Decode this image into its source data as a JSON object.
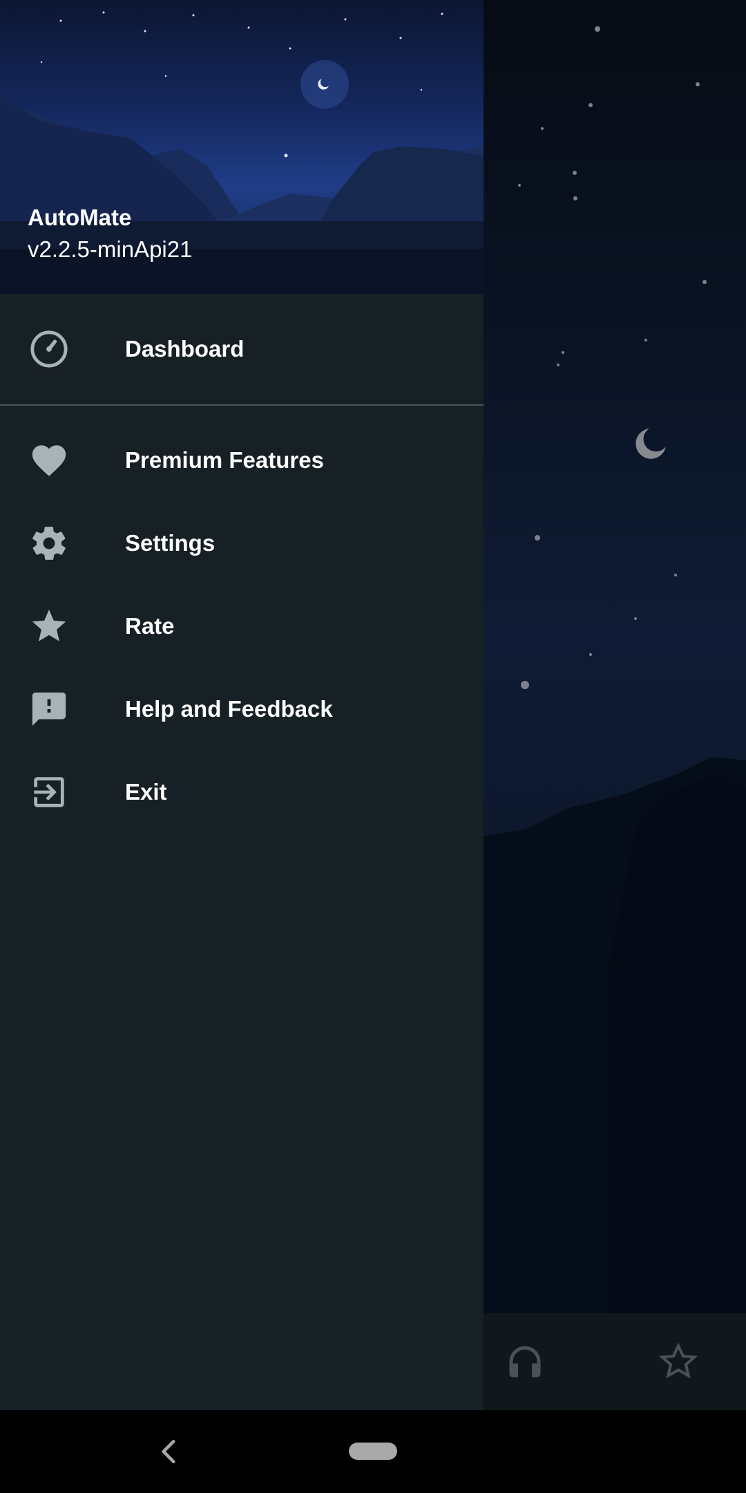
{
  "drawer": {
    "app_name": "AutoMate",
    "app_version": "v2.2.5-minApi21",
    "primary_items": [
      {
        "label": "Dashboard",
        "icon": "dashboard-gauge-icon"
      }
    ],
    "secondary_items": [
      {
        "label": "Premium Features",
        "icon": "heart-icon"
      },
      {
        "label": "Settings",
        "icon": "gear-icon"
      },
      {
        "label": "Rate",
        "icon": "star-icon"
      },
      {
        "label": "Help and Feedback",
        "icon": "feedback-icon"
      },
      {
        "label": "Exit",
        "icon": "exit-icon"
      }
    ]
  },
  "background_app": {
    "bottom_bar_icons": [
      "headphones-icon",
      "star-outline-icon"
    ]
  },
  "system_nav": {
    "icons": [
      "back-icon",
      "home-pill"
    ]
  },
  "colors": {
    "drawer_bg": "#172024",
    "icon_color": "#a8b3b6",
    "text_color": "#ffffff"
  }
}
